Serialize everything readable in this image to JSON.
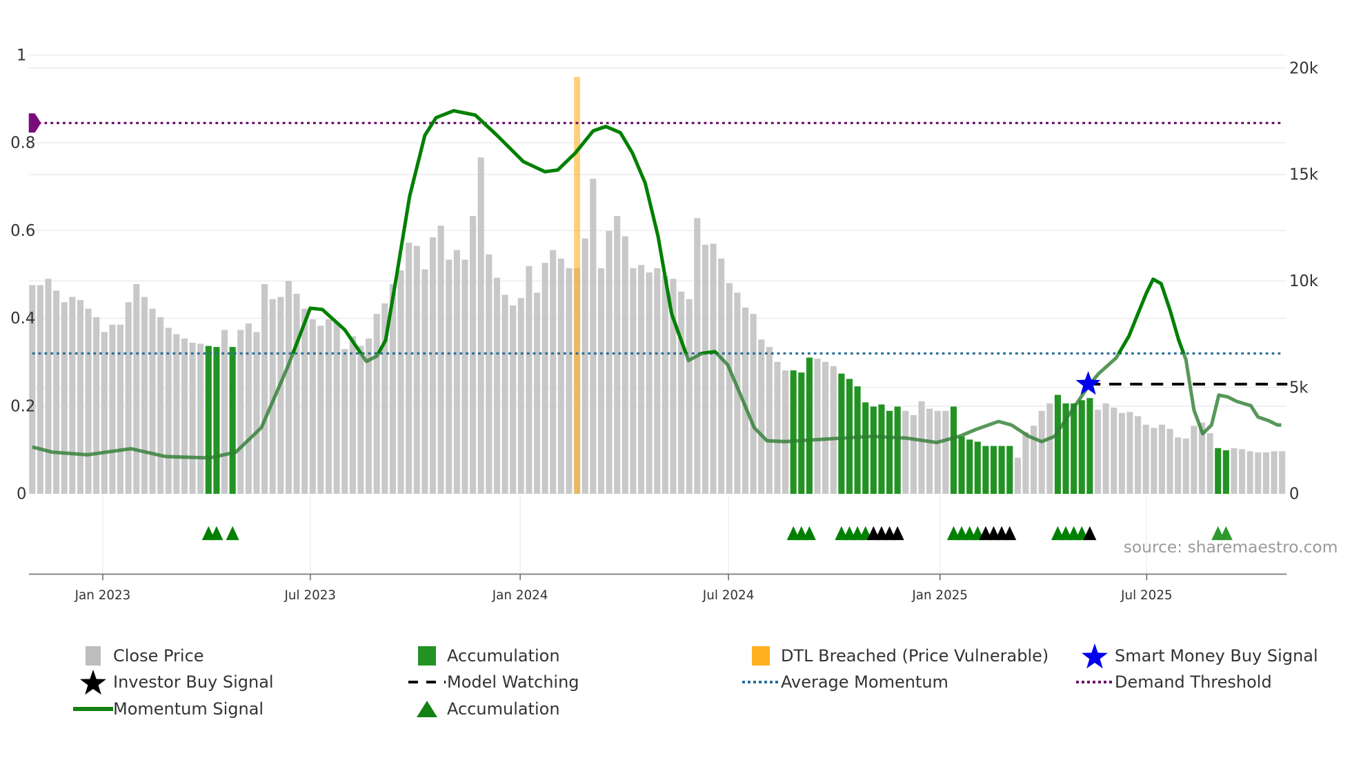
{
  "chart_data": {
    "type": "bar",
    "title": "",
    "left_axis": {
      "ticks": [
        "0",
        "0.2",
        "0.4",
        "0.6",
        "0.8",
        "1"
      ],
      "tick_values": [
        0,
        0.2,
        0.4,
        0.6,
        0.8,
        1
      ],
      "range": [
        0,
        1
      ]
    },
    "right_axis": {
      "ticks": [
        "0",
        "5k",
        "10k",
        "15k",
        "20k"
      ],
      "tick_values": [
        0,
        5000,
        10000,
        15000,
        20000
      ],
      "range": [
        0,
        20600
      ]
    },
    "x_ticks": [
      {
        "label": "Jan 2023",
        "week": 8.8
      },
      {
        "label": "Jul 2023",
        "week": 34.7
      },
      {
        "label": "Jan 2024",
        "week": 60.9
      },
      {
        "label": "Jul 2024",
        "week": 86.9
      },
      {
        "label": "Jan 2025",
        "week": 113.3
      },
      {
        "label": "Jul 2025",
        "week": 139.1
      }
    ],
    "close_price": [
      9800,
      9800,
      10100,
      9550,
      9000,
      9250,
      9100,
      8700,
      8300,
      7600,
      7950,
      7950,
      9000,
      9850,
      9250,
      8700,
      8300,
      7800,
      7500,
      7300,
      7100,
      7050,
      6950,
      6900,
      7700,
      6900,
      7700,
      8000,
      7600,
      9850,
      9150,
      9250,
      10000,
      9400,
      8700,
      8200,
      7900,
      8200,
      8050,
      6800,
      7400,
      6950,
      7300,
      8450,
      8950,
      9850,
      10500,
      11800,
      11650,
      10550,
      12050,
      12600,
      11000,
      11450,
      11000,
      13050,
      15800,
      11250,
      10150,
      9350,
      8850,
      9200,
      10700,
      9450,
      10850,
      11450,
      11050,
      10600,
      10600,
      12000,
      14800,
      10600,
      12350,
      13050,
      12100,
      10600,
      10750,
      10400,
      10600,
      10250,
      10100,
      9500,
      9150,
      12950,
      11700,
      11750,
      11050,
      9900,
      9450,
      8750,
      8450,
      7250,
      6900,
      6200,
      5800,
      5800,
      5700,
      6400,
      6350,
      6200,
      6000,
      5650,
      5400,
      5050,
      4300,
      4100,
      4200,
      3900,
      4100,
      3900,
      3700,
      4350,
      4000,
      3900,
      3900,
      4100,
      2700,
      2550,
      2450,
      2250,
      2250,
      2250,
      2250,
      1700,
      2900,
      3200,
      3900,
      4250,
      4650,
      4250,
      4250,
      4400,
      4500,
      3950,
      4250,
      4050,
      3800,
      3850,
      3650,
      3250,
      3100,
      3250,
      3050,
      2650,
      2600,
      3200,
      3350,
      2850,
      2150,
      2050,
      2150,
      2100,
      2000,
      1950,
      1950,
      2000,
      2000
    ],
    "accumulation_weeks": [
      22,
      23,
      25,
      95,
      96,
      97,
      101,
      102,
      103,
      104,
      105,
      106,
      107,
      108,
      115,
      116,
      117,
      118,
      119,
      120,
      121,
      122,
      128,
      129,
      130,
      131,
      132,
      148,
      149
    ],
    "dtl_breached_week": 68,
    "dtl_breached_level": 0.95,
    "momentum": [
      [
        0,
        0.107
      ],
      [
        2.5,
        0.095
      ],
      [
        6.9,
        0.089
      ],
      [
        12.3,
        0.103
      ],
      [
        16.6,
        0.085
      ],
      [
        22.1,
        0.082
      ],
      [
        25.4,
        0.095
      ],
      [
        28.6,
        0.151
      ],
      [
        31.9,
        0.29
      ],
      [
        34.7,
        0.423
      ],
      [
        36.2,
        0.42
      ],
      [
        39,
        0.374
      ],
      [
        41.7,
        0.302
      ],
      [
        43,
        0.314
      ],
      [
        44.1,
        0.35
      ],
      [
        45.5,
        0.5
      ],
      [
        47.1,
        0.678
      ],
      [
        49,
        0.817
      ],
      [
        50.4,
        0.857
      ],
      [
        52.6,
        0.873
      ],
      [
        55.3,
        0.863
      ],
      [
        58,
        0.817
      ],
      [
        61.3,
        0.757
      ],
      [
        64,
        0.734
      ],
      [
        65.6,
        0.738
      ],
      [
        67.8,
        0.777
      ],
      [
        70,
        0.827
      ],
      [
        71.6,
        0.837
      ],
      [
        73.4,
        0.823
      ],
      [
        74.9,
        0.777
      ],
      [
        76.5,
        0.708
      ],
      [
        78.1,
        0.588
      ],
      [
        79.8,
        0.41
      ],
      [
        81.9,
        0.304
      ],
      [
        83.6,
        0.32
      ],
      [
        85.2,
        0.324
      ],
      [
        86.8,
        0.294
      ],
      [
        88.5,
        0.221
      ],
      [
        90.1,
        0.151
      ],
      [
        91.7,
        0.121
      ],
      [
        93.9,
        0.119
      ],
      [
        99.3,
        0.125
      ],
      [
        104.8,
        0.131
      ],
      [
        109.1,
        0.127
      ],
      [
        112.9,
        0.117
      ],
      [
        115.7,
        0.131
      ],
      [
        117.8,
        0.147
      ],
      [
        120.6,
        0.165
      ],
      [
        122.2,
        0.157
      ],
      [
        124.4,
        0.131
      ],
      [
        126,
        0.119
      ],
      [
        127.6,
        0.131
      ],
      [
        129.8,
        0.191
      ],
      [
        132,
        0.25
      ],
      [
        133.1,
        0.274
      ],
      [
        135.3,
        0.31
      ],
      [
        136.9,
        0.36
      ],
      [
        138,
        0.41
      ],
      [
        139.1,
        0.459
      ],
      [
        139.9,
        0.489
      ],
      [
        140.9,
        0.479
      ],
      [
        142,
        0.419
      ],
      [
        143.1,
        0.35
      ],
      [
        144,
        0.306
      ],
      [
        145,
        0.191
      ],
      [
        146.1,
        0.137
      ],
      [
        147.2,
        0.157
      ],
      [
        148.1,
        0.225
      ],
      [
        149.2,
        0.221
      ],
      [
        150.3,
        0.211
      ],
      [
        152.1,
        0.201
      ],
      [
        153,
        0.175
      ],
      [
        154.3,
        0.167
      ],
      [
        155.4,
        0.157
      ],
      [
        155.9,
        0.157
      ]
    ],
    "average_momentum": 0.32,
    "demand_threshold": 0.845,
    "smart_money_buy_signal": {
      "week": 131.8,
      "value": 0.25
    },
    "model_watching": {
      "from_week": 131.8,
      "to_week": 156,
      "value": 0.25
    },
    "accumulation_markers": [
      {
        "week": 22,
        "type": "accumulation"
      },
      {
        "week": 23,
        "type": "accumulation"
      },
      {
        "week": 25,
        "type": "accumulation"
      },
      {
        "week": 95,
        "type": "accumulation"
      },
      {
        "week": 96,
        "type": "accumulation"
      },
      {
        "week": 97,
        "type": "accumulation"
      },
      {
        "week": 101,
        "type": "accumulation"
      },
      {
        "week": 102,
        "type": "accumulation"
      },
      {
        "week": 103,
        "type": "accumulation"
      },
      {
        "week": 104,
        "type": "accumulation"
      },
      {
        "week": 105,
        "type": "investor"
      },
      {
        "week": 106,
        "type": "investor"
      },
      {
        "week": 107,
        "type": "investor"
      },
      {
        "week": 108,
        "type": "investor"
      },
      {
        "week": 115,
        "type": "accumulation"
      },
      {
        "week": 116,
        "type": "accumulation"
      },
      {
        "week": 117,
        "type": "accumulation"
      },
      {
        "week": 118,
        "type": "accumulation"
      },
      {
        "week": 119,
        "type": "investor"
      },
      {
        "week": 120,
        "type": "investor"
      },
      {
        "week": 121,
        "type": "investor"
      },
      {
        "week": 122,
        "type": "investor"
      },
      {
        "week": 128,
        "type": "accumulation"
      },
      {
        "week": 129,
        "type": "accumulation"
      },
      {
        "week": 130,
        "type": "accumulation"
      },
      {
        "week": 131,
        "type": "accumulation"
      },
      {
        "week": 132,
        "type": "investor"
      },
      {
        "week": 148,
        "type": "accumulation-light"
      },
      {
        "week": 149,
        "type": "accumulation-light"
      }
    ],
    "source": "source: sharemaestro.com",
    "legend_placement": "bottom"
  },
  "colors": {
    "close_price": "#c8c8c8",
    "accumulation_bar": "#229322",
    "dtl": "#ffb020",
    "smart_money": "#0000ee",
    "investor": "#000000",
    "model_watching": "#000000",
    "average_momentum": "#2a6f9b",
    "demand_threshold": "#6b0f6b",
    "momentum": "#008000",
    "accumulation_marker": "#008000"
  },
  "legend": [
    {
      "label": "Close Price",
      "icon": "grey-bar"
    },
    {
      "label": "Accumulation",
      "icon": "green-bar"
    },
    {
      "label": "DTL Breached (Price Vulnerable)",
      "icon": "orange-bar"
    },
    {
      "label": "Smart Money Buy Signal",
      "icon": "blue-star"
    },
    {
      "label": "Investor Buy Signal",
      "icon": "black-star"
    },
    {
      "label": "Model Watching",
      "icon": "dashed-line"
    },
    {
      "label": "Average Momentum",
      "icon": "blue-dotted-line"
    },
    {
      "label": "Demand Threshold",
      "icon": "purple-dotted-line"
    },
    {
      "label": "Momentum Signal",
      "icon": "green-line"
    },
    {
      "label": "Accumulation",
      "icon": "green-triangle"
    }
  ]
}
